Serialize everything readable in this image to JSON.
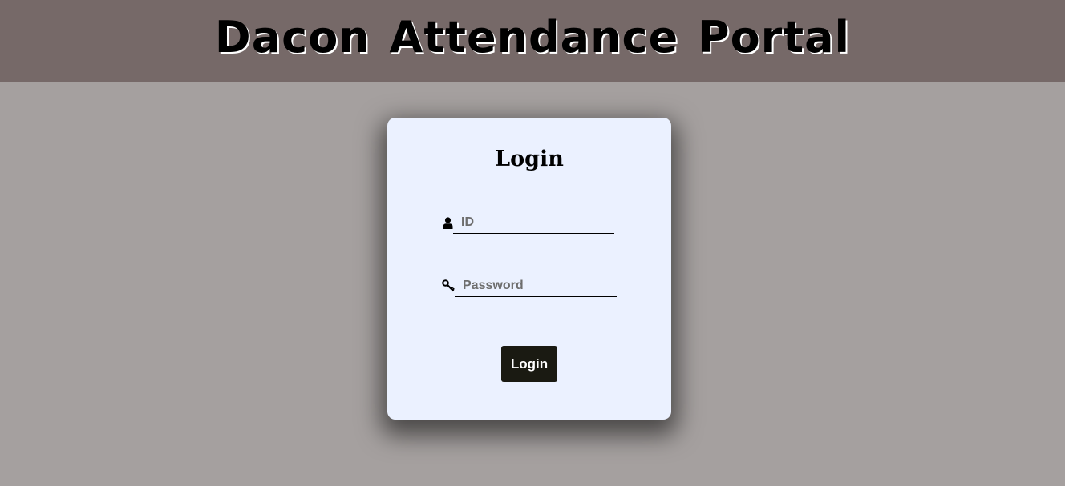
{
  "header": {
    "title": "Dacon Attendance Portal"
  },
  "login_card": {
    "title": "Login",
    "id_field": {
      "placeholder": "ID",
      "value": "",
      "icon": "user-icon"
    },
    "password_field": {
      "placeholder": "Password",
      "value": "",
      "icon": "key-icon"
    },
    "submit_label": "Login"
  },
  "colors": {
    "header_bg": "#766968",
    "page_bg": "#a5a09f",
    "card_bg": "#ebf1ff",
    "button_bg": "#1a1a12"
  }
}
